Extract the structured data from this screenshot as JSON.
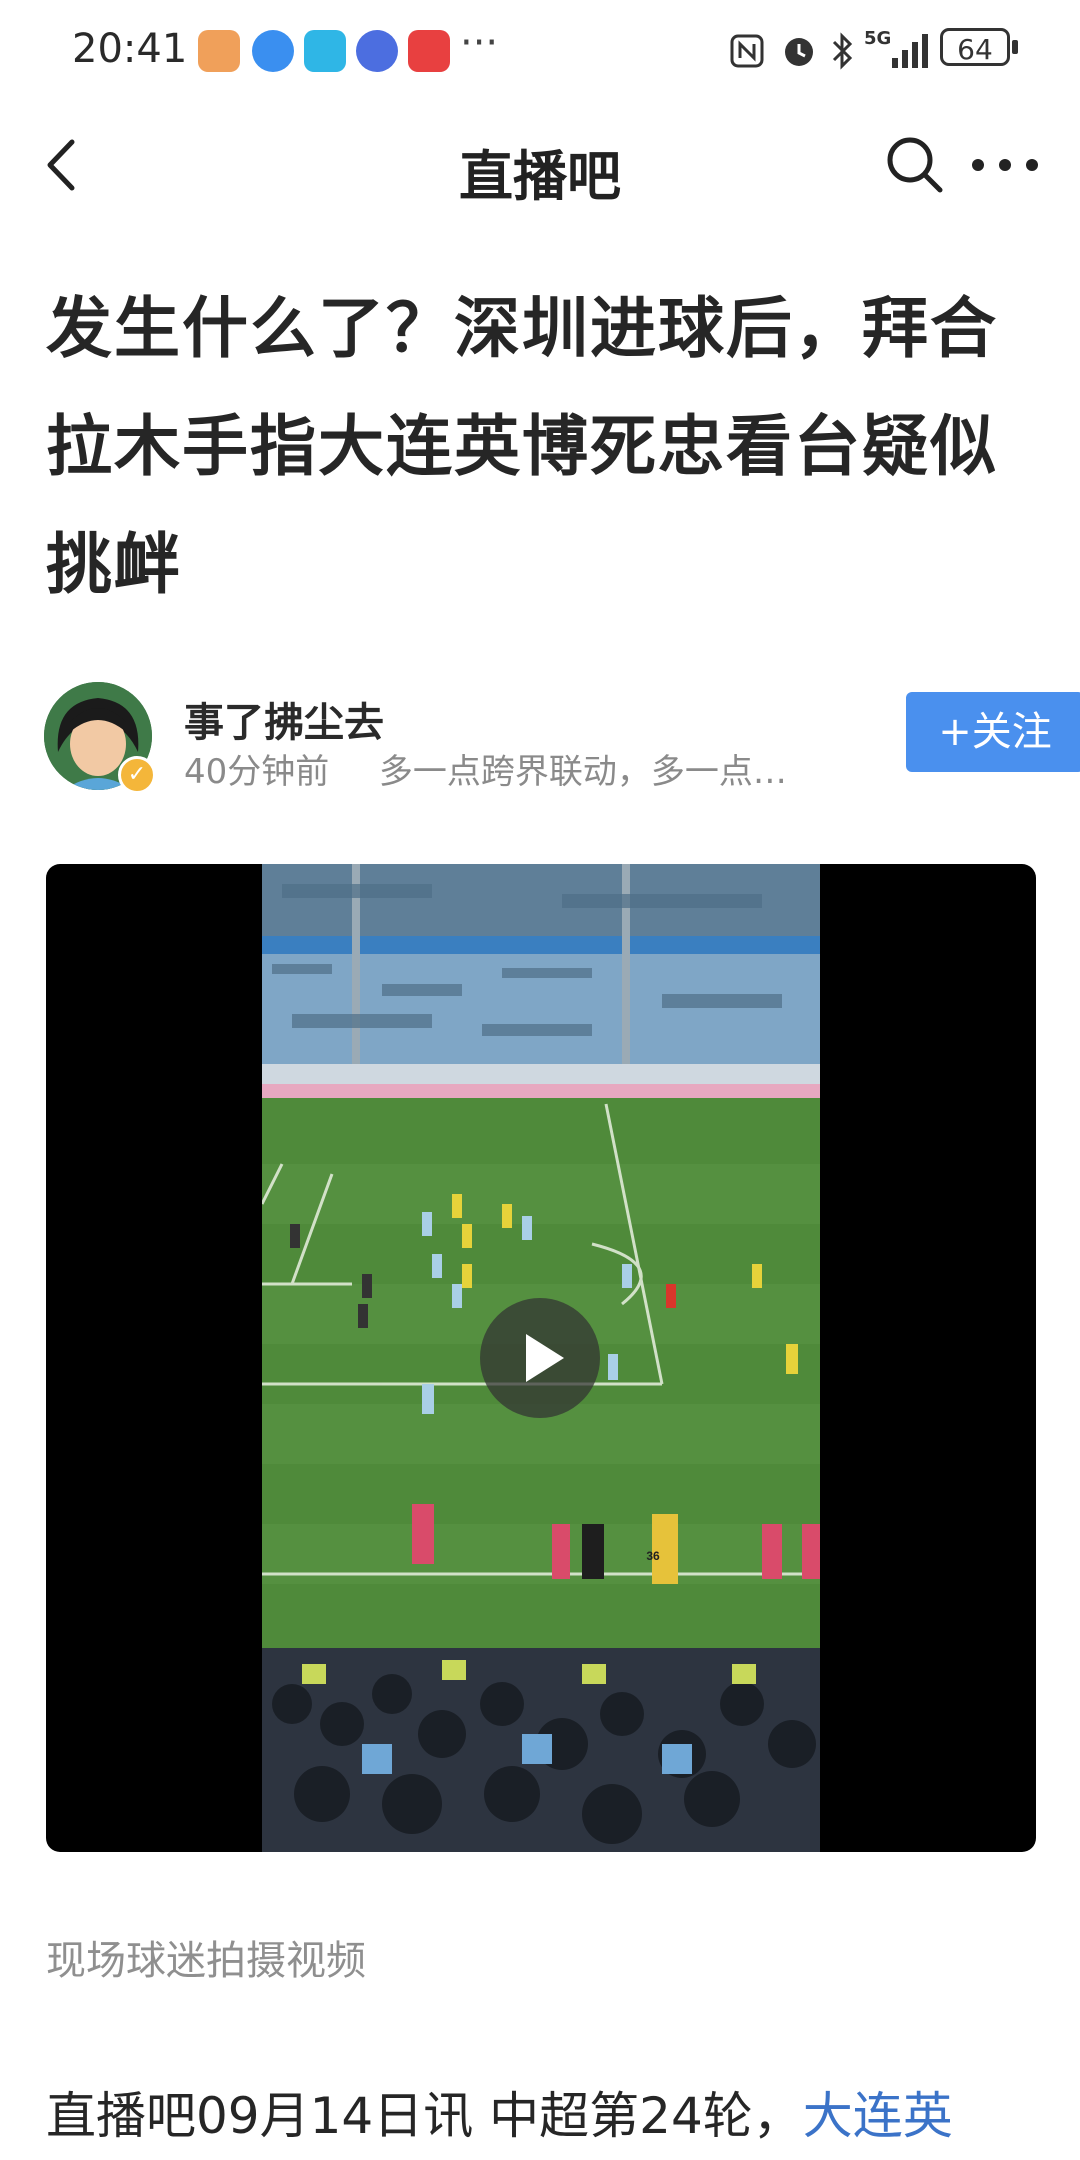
{
  "status_bar": {
    "time": "20:41",
    "ellipsis": "···",
    "network": "5G",
    "battery": "64"
  },
  "nav": {
    "title": "直播吧"
  },
  "article": {
    "headline": "发生什么了？深圳进球后，拜合拉木手指大连英博死忠看台疑似挑衅",
    "author": {
      "name": "事了拂尘去",
      "time": "40分钟前",
      "bio": "多一点跨界联动，多一点…"
    },
    "follow_label": "+关注",
    "video": {
      "jersey_number": "36"
    },
    "caption": "现场球迷拍摄视频",
    "body_text": "直播吧09月14日讯 中超第24轮，",
    "body_link": "大连英"
  },
  "colors": {
    "accent": "#4a90ee",
    "link": "#3b73c8",
    "pitch": "#4f8a3a",
    "crowd": "#7fa6c6"
  }
}
